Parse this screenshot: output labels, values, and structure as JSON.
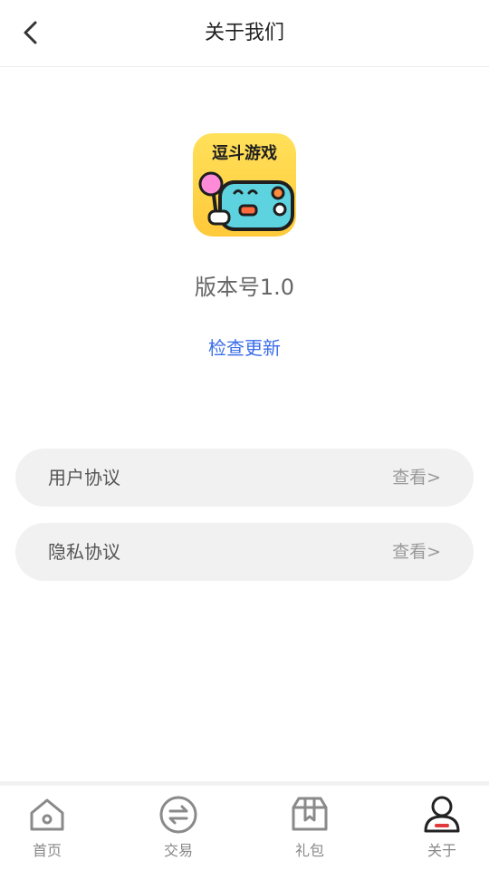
{
  "header": {
    "title": "关于我们",
    "back_icon": "back-arrow-icon"
  },
  "app": {
    "logo_text": "逗斗游戏",
    "version_label": "版本号1.0",
    "check_update_label": "检查更新"
  },
  "agreements": [
    {
      "label": "用户协议",
      "action": "查看>"
    },
    {
      "label": "隐私协议",
      "action": "查看>"
    }
  ],
  "tabs": [
    {
      "label": "首页",
      "icon": "home-icon"
    },
    {
      "label": "交易",
      "icon": "exchange-icon"
    },
    {
      "label": "礼包",
      "icon": "gift-box-icon"
    },
    {
      "label": "关于",
      "icon": "user-icon",
      "active": true
    }
  ],
  "colors": {
    "link": "#3a6ee8",
    "accent": "#e03a3a",
    "logo_bg": "#ffd84a"
  }
}
